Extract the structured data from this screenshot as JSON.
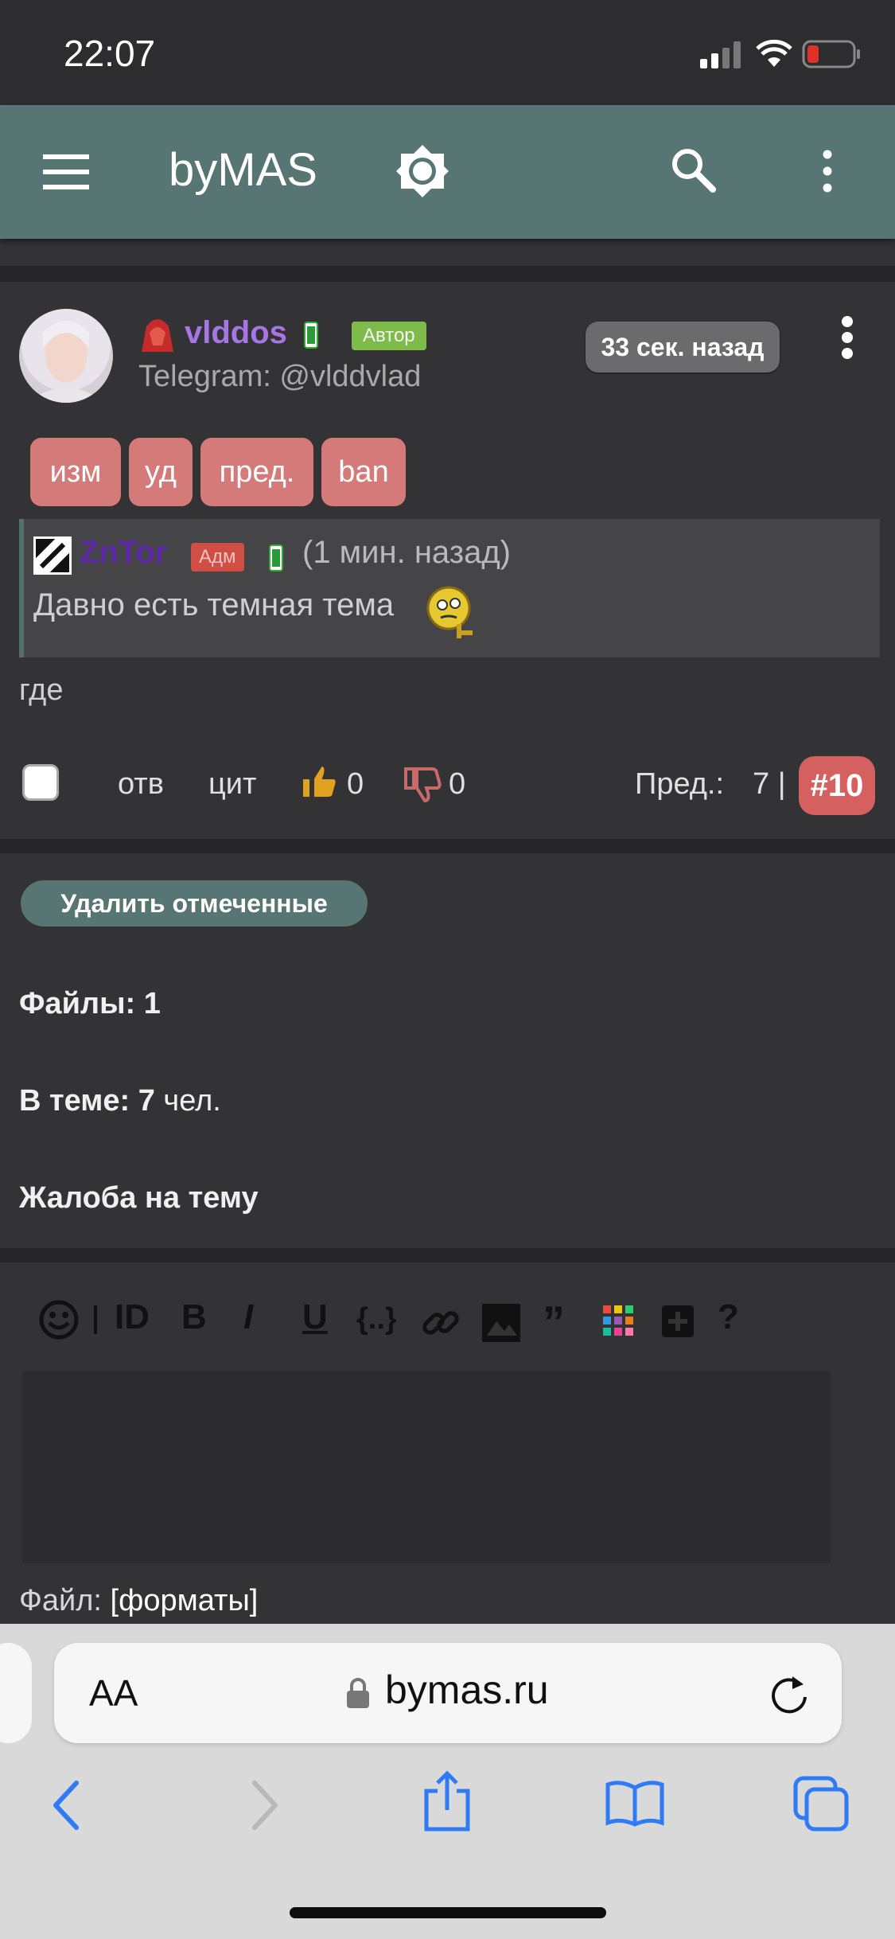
{
  "status": {
    "time": "22:07"
  },
  "appbar": {
    "title": "byMAS"
  },
  "post": {
    "username": "vlddos",
    "author_badge": "Автор",
    "telegram": "Telegram: @vlddvlad",
    "time": "33 сек. назад",
    "mod_buttons": [
      "изм",
      "уд",
      "пред.",
      "ban"
    ],
    "quote": {
      "username": "ZnTor",
      "role": "Адм",
      "time": "(1 мин. назад)",
      "text": "Давно есть темная тема"
    },
    "text": "где",
    "actions": {
      "reply": "отв",
      "quote": "цит",
      "likes": "0",
      "dislikes": "0"
    },
    "warnings_label": "Пред.:",
    "warnings_value": "7 |",
    "number": "#10"
  },
  "topic": {
    "delete_selected": "Удалить отмеченные",
    "files_label": "Файлы:",
    "files_count": "1",
    "members_label": "В теме:",
    "members_count": "7",
    "members_unit": "чел.",
    "complaint": "Жалоба на тему"
  },
  "editor": {
    "toolbar": [
      "emoji-icon",
      "separator",
      "id-icon",
      "bold-icon",
      "italic-icon",
      "underline-icon",
      "code-icon",
      "link-icon",
      "image-icon",
      "quote-icon",
      "color-icon",
      "add-icon",
      "help-icon"
    ],
    "file_label": "Файл:",
    "formats_link": "[форматы]"
  },
  "safari": {
    "text_size": "AA",
    "url": "bymas.ru"
  }
}
